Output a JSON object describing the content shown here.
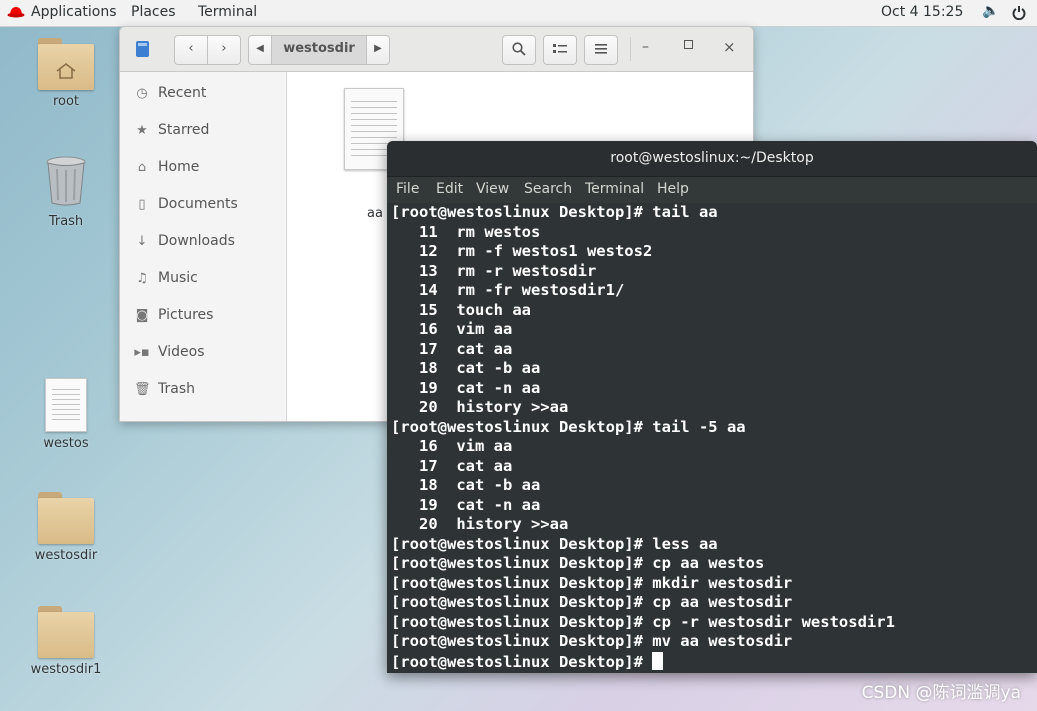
{
  "topbar": {
    "applications": "Applications",
    "places": "Places",
    "terminal": "Terminal",
    "clock": "Oct 4  15:25"
  },
  "desktop": {
    "icons": [
      {
        "label": "root",
        "icon": "home-folder-icon"
      },
      {
        "label": "Trash",
        "icon": "trash-icon"
      },
      {
        "label": "westos",
        "icon": "document-icon"
      },
      {
        "label": "westosdir",
        "icon": "folder-icon"
      },
      {
        "label": "westosdir1",
        "icon": "folder-icon"
      }
    ]
  },
  "file_manager": {
    "path_segment": "westosdir",
    "sidebar": [
      {
        "label": "Recent",
        "icon": "clock-icon"
      },
      {
        "label": "Starred",
        "icon": "star-icon"
      },
      {
        "label": "Home",
        "icon": "home-icon"
      },
      {
        "label": "Documents",
        "icon": "document-icon"
      },
      {
        "label": "Downloads",
        "icon": "download-icon"
      },
      {
        "label": "Music",
        "icon": "music-icon"
      },
      {
        "label": "Pictures",
        "icon": "camera-icon"
      },
      {
        "label": "Videos",
        "icon": "video-icon"
      },
      {
        "label": "Trash",
        "icon": "trash-icon"
      }
    ],
    "files": [
      {
        "name": "aa"
      }
    ]
  },
  "terminal": {
    "title": "root@westoslinux:~/Desktop",
    "menu": [
      "File",
      "Edit",
      "View",
      "Search",
      "Terminal",
      "Help"
    ],
    "lines": [
      "[root@westoslinux Desktop]# tail aa",
      "   11  rm westos",
      "   12  rm -f westos1 westos2",
      "   13  rm -r westosdir",
      "   14  rm -fr westosdir1/",
      "   15  touch aa",
      "   16  vim aa",
      "   17  cat aa",
      "   18  cat -b aa",
      "   19  cat -n aa",
      "   20  history >>aa",
      "[root@westoslinux Desktop]# tail -5 aa",
      "   16  vim aa",
      "   17  cat aa",
      "   18  cat -b aa",
      "   19  cat -n aa",
      "   20  history >>aa",
      "[root@westoslinux Desktop]# less aa",
      "[root@westoslinux Desktop]# cp aa westos",
      "[root@westoslinux Desktop]# mkdir westosdir",
      "[root@westoslinux Desktop]# cp aa westosdir",
      "[root@westoslinux Desktop]# cp -r westosdir westosdir1",
      "[root@westoslinux Desktop]# mv aa westosdir"
    ],
    "prompt": "[root@westoslinux Desktop]# "
  },
  "watermark": "CSDN @陈词滥调ya",
  "colors": {
    "terminal_bg": "#2e3436",
    "terminal_fg": "#ffffff",
    "topbar_bg": "#f2f2f2"
  }
}
